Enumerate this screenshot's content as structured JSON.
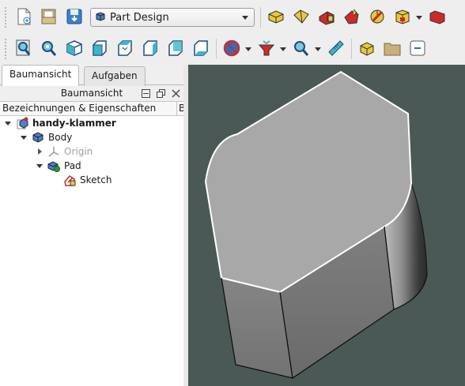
{
  "workbench": {
    "selected": "Part Design"
  },
  "panel": {
    "tabs": [
      "Baumansicht",
      "Aufgaben"
    ],
    "dock_title": "Baumansicht",
    "columns": [
      "Bezeichnungen & Eigenschaften",
      "B"
    ]
  },
  "tree": {
    "document": "handy-klammer",
    "body": "Body",
    "origin": "Origin",
    "pad": "Pad",
    "sketch": "Sketch"
  },
  "icons": {
    "toolbar1": [
      "new-document-icon",
      "open-document-icon",
      "save-document-icon",
      "workbench-selector",
      "create-body-icon",
      "create-part-icon",
      "create-sketch-icon",
      "validate-sketch-icon",
      "pad-icon",
      "attach-sketch-icon",
      "box-icon"
    ],
    "toolbar2": [
      "fit-all-icon",
      "fit-selection-icon",
      "isometric-view-icon",
      "front-view-icon",
      "top-view-icon",
      "right-view-icon",
      "rear-view-icon",
      "bottom-view-icon",
      "draw-style-icon",
      "std-views-menu-icon",
      "measure-icon",
      "part-icon",
      "group-icon",
      "link-icon"
    ]
  },
  "colors": {
    "viewport_bg": "#4b5956",
    "model_top": "#a8a8a8",
    "selection_edge": "#ffffff"
  }
}
